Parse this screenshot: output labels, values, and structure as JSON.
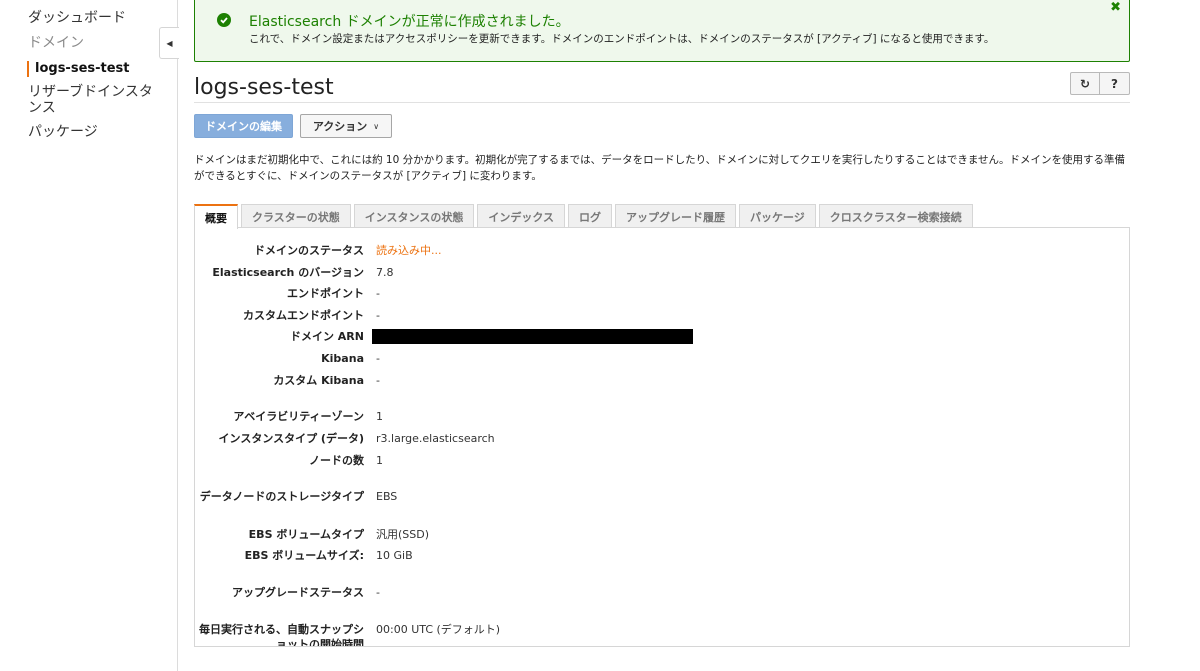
{
  "sidebar": {
    "items": [
      {
        "label": "ダッシュボード",
        "state": "normal"
      },
      {
        "label": "ドメイン",
        "state": "disabled"
      },
      {
        "label": "logs-ses-test",
        "state": "active"
      },
      {
        "label": "リザーブドインスタンス",
        "state": "normal"
      },
      {
        "label": "パッケージ",
        "state": "normal"
      }
    ],
    "collapse_icon": "caret-left-icon"
  },
  "flash": {
    "title": "Elasticsearch ドメインが正常に作成されました。",
    "body": "これで、ドメイン設定またはアクセスポリシーを更新できます。ドメインのエンドポイントは、ドメインのステータスが [アクティブ] になると使用できます。",
    "close_symbol": "✖",
    "accent": "#1d8102"
  },
  "page": {
    "title": "logs-ses-test",
    "refresh_symbol": "↻",
    "help_symbol": "?"
  },
  "buttons": {
    "edit_label": "ドメインの編集",
    "action_label": "アクション",
    "action_chevron": "∨"
  },
  "info_text": "ドメインはまだ初期化中で、これには約 10 分かかります。初期化が完了するまでは、データをロードしたり、ドメインに対してクエリを実行したりすることはできません。ドメインを使用する準備ができるとすぐに、ドメインのステータスが [アクティブ] に変わります。",
  "tabs": [
    {
      "label": "概要",
      "active": true
    },
    {
      "label": "クラスターの状態",
      "active": false
    },
    {
      "label": "インスタンスの状態",
      "active": false
    },
    {
      "label": "インデックス",
      "active": false
    },
    {
      "label": "ログ",
      "active": false
    },
    {
      "label": "アップグレード履歴",
      "active": false
    },
    {
      "label": "パッケージ",
      "active": false
    },
    {
      "label": "クロスクラスター検索接続",
      "active": false
    }
  ],
  "details": [
    {
      "label": "ドメインのステータス",
      "value": "読み込み中..."
    },
    {
      "label": "Elasticsearch のバージョン",
      "value": "7.8"
    },
    {
      "label": "エンドポイント",
      "value": "-"
    },
    {
      "label": "カスタムエンドポイント",
      "value": "-"
    },
    {
      "label": "ドメイン ARN",
      "value": ""
    },
    {
      "label": "Kibana",
      "value": "-"
    },
    {
      "label": "カスタム Kibana",
      "value": "-"
    },
    {
      "label": "アベイラビリティーゾーン",
      "value": "1"
    },
    {
      "label": "インスタンスタイプ (データ)",
      "value": "r3.large.elasticsearch"
    },
    {
      "label": "ノードの数",
      "value": "1"
    },
    {
      "label": "データノードのストレージタイプ",
      "value": "EBS"
    },
    {
      "label": "EBS ボリュームタイプ",
      "value": "汎用(SSD)"
    },
    {
      "label": "EBS ボリュームサイズ:",
      "value": "10 GiB"
    },
    {
      "label": "アップグレードステータス",
      "value": "-"
    },
    {
      "label": "毎日実行される、自動スナップショットの開始時間",
      "value": "00:00 UTC (デフォルト)"
    }
  ],
  "colors": {
    "accent_orange": "#ec7211",
    "success_green": "#1d8102",
    "primary_button": "#87aedd"
  }
}
